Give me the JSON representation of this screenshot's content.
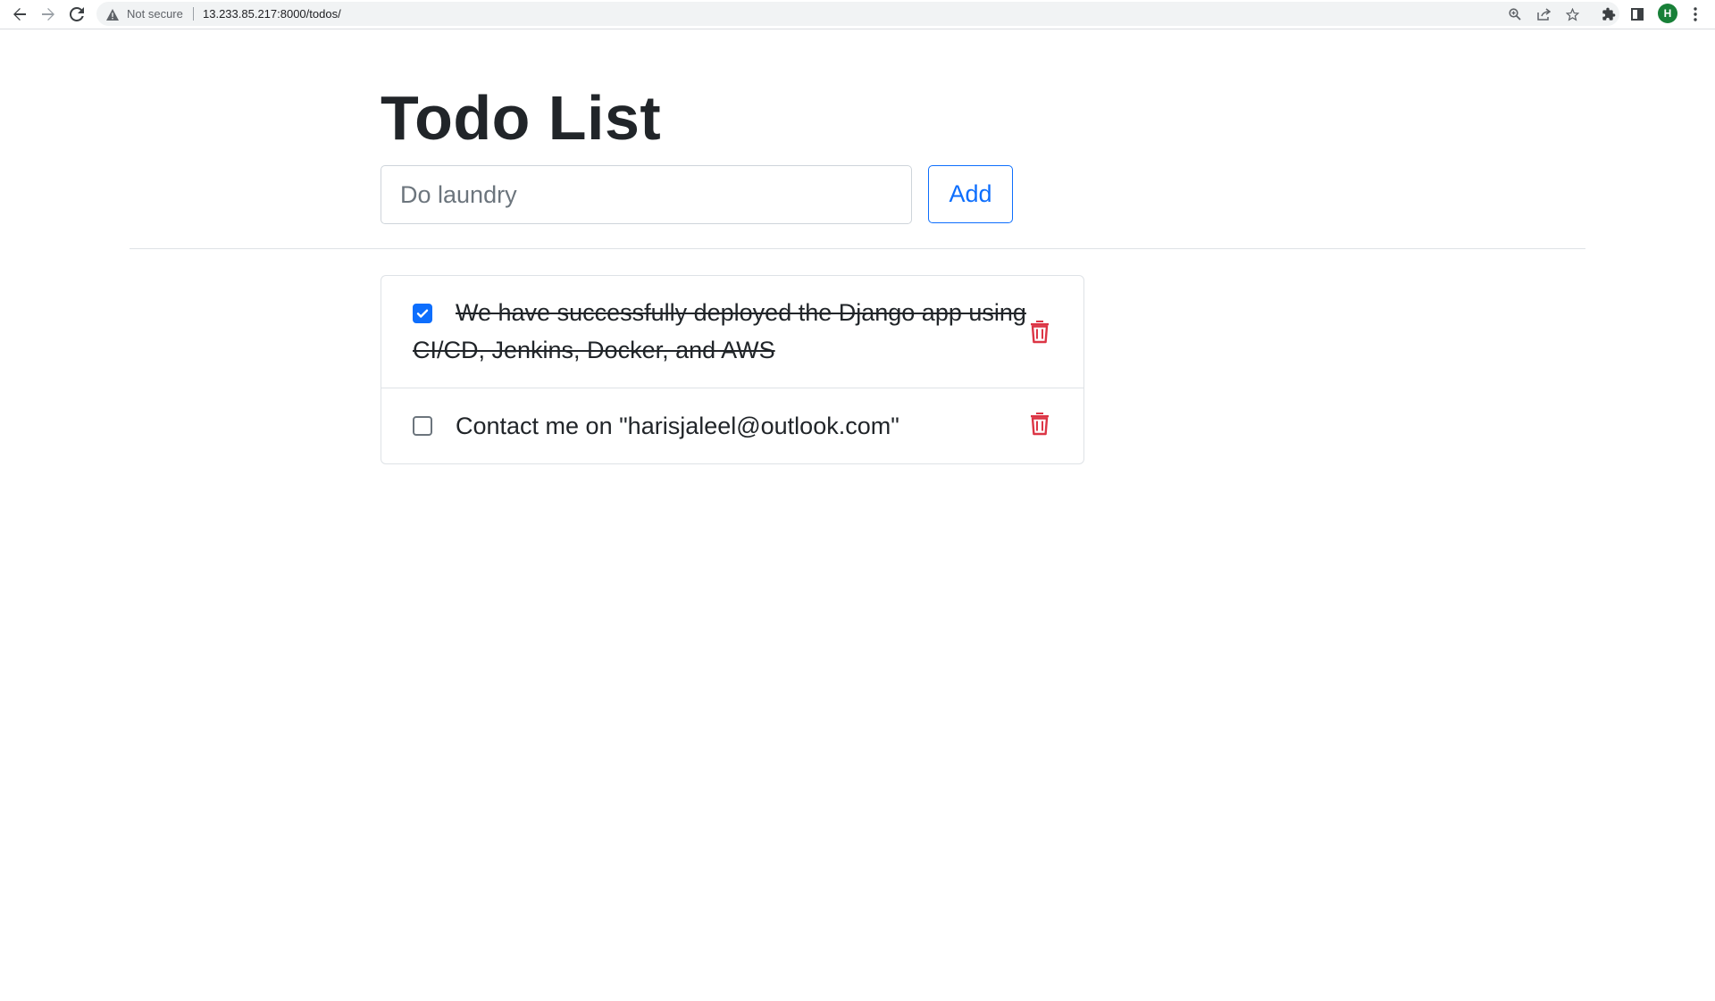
{
  "browser": {
    "security_label": "Not secure",
    "url": "13.233.85.217:8000/todos/",
    "avatar_letter": "H"
  },
  "page": {
    "title": "Todo List"
  },
  "form": {
    "input_placeholder": "Do laundry",
    "input_value": "",
    "add_label": "Add"
  },
  "todos": [
    {
      "text": "We have successfully deployed the Django app using CI/CD, Jenkins, Docker, and AWS",
      "completed": true
    },
    {
      "text": "Contact me on \"harisjaleel@outlook.com\"",
      "completed": false
    }
  ],
  "colors": {
    "primary": "#0d6efd",
    "danger": "#dc3545",
    "text": "#212529",
    "border": "#dee2e6"
  },
  "icons": {
    "back": "arrow-left-icon",
    "forward": "arrow-right-icon",
    "reload": "reload-icon",
    "warning": "warning-triangle-icon",
    "zoom": "zoom-icon",
    "share": "share-icon",
    "bookmark": "star-icon",
    "extensions": "puzzle-icon",
    "side_panel": "side-panel-icon",
    "menu": "kebab-menu-icon",
    "delete": "trash-icon"
  }
}
